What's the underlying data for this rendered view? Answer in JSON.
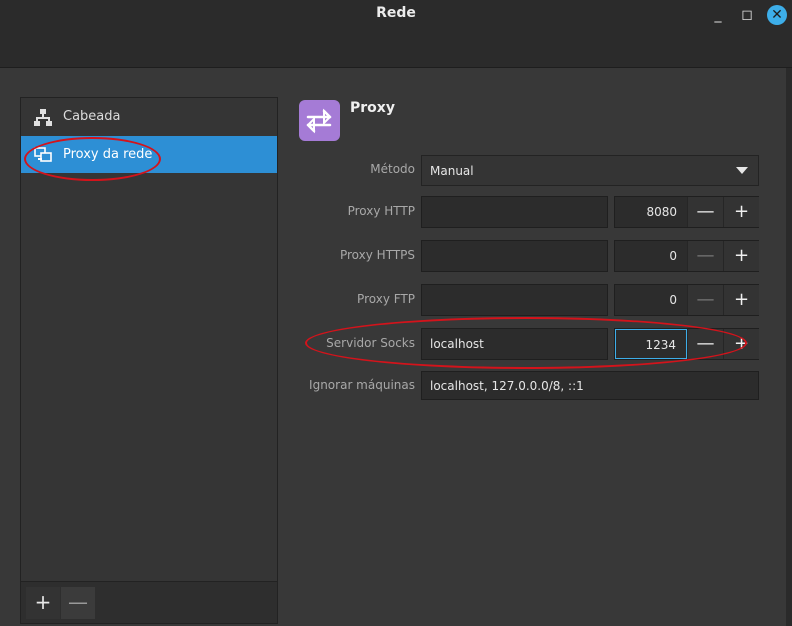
{
  "window": {
    "title": "Rede"
  },
  "sidebar": {
    "items": [
      {
        "label": "Cabeada",
        "icon": "network-wired-icon",
        "active": false
      },
      {
        "label": "Proxy da rede",
        "icon": "proxy-icon",
        "active": true
      }
    ],
    "add_label": "+",
    "remove_label": "—"
  },
  "proxy": {
    "title": "Proxy",
    "method": {
      "label": "Método",
      "value": "Manual"
    },
    "http": {
      "label": "Proxy HTTP",
      "host": "",
      "port": "8080"
    },
    "https": {
      "label": "Proxy HTTPS",
      "host": "",
      "port": "0"
    },
    "ftp": {
      "label": "Proxy FTP",
      "host": "",
      "port": "0"
    },
    "socks": {
      "label": "Servidor Socks",
      "host": "localhost",
      "port": "1234"
    },
    "ignore": {
      "label": "Ignorar máquinas",
      "value": "localhost, 127.0.0.0/8, ::1"
    }
  },
  "colors": {
    "accent": "#2d8fd5",
    "annotation": "#d4131b",
    "proxy_icon": "#a57bd6"
  }
}
